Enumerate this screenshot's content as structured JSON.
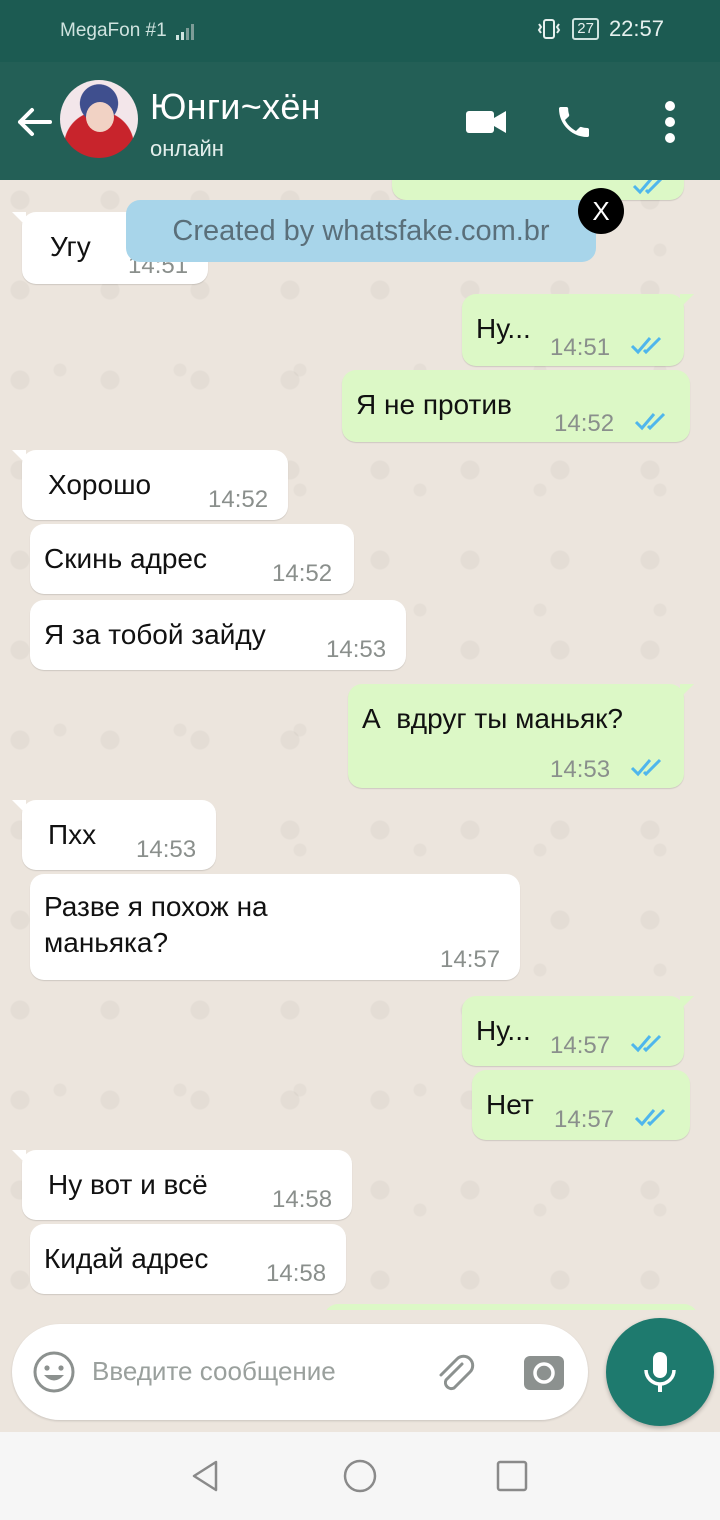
{
  "status_bar": {
    "carrier": "MegaFon #1",
    "battery": "27",
    "time": "22:57"
  },
  "header": {
    "contact_name": "Юнги~хён",
    "status": "онлайн"
  },
  "banner": {
    "text": "Created by whatsfake.com.br",
    "close_label": "X"
  },
  "messages": [
    {
      "dir": "in",
      "text": "Угу",
      "time": "14:51"
    },
    {
      "dir": "out",
      "text": "Ну...",
      "time": "14:51",
      "read": true
    },
    {
      "dir": "out",
      "text": "Я не против",
      "time": "14:52",
      "read": true
    },
    {
      "dir": "in",
      "text": "Хорошо",
      "time": "14:52"
    },
    {
      "dir": "in",
      "text": "Скинь адрес",
      "time": "14:52"
    },
    {
      "dir": "in",
      "text": "Я за тобой зайду",
      "time": "14:53"
    },
    {
      "dir": "out",
      "text": "А  вдруг ты маньяк?",
      "time": "14:53",
      "read": true
    },
    {
      "dir": "in",
      "text": "Пхх",
      "time": "14:53"
    },
    {
      "dir": "in",
      "text_line1": "Разве я похож на",
      "text_line2": "маньяка?",
      "time": "14:57"
    },
    {
      "dir": "out",
      "text": "Ну...",
      "time": "14:57",
      "read": true
    },
    {
      "dir": "out",
      "text": "Нет",
      "time": "14:57",
      "read": true
    },
    {
      "dir": "in",
      "text": "Ну вот и всё",
      "time": "14:58"
    },
    {
      "dir": "in",
      "text": "Кидай адрес",
      "time": "14:58"
    }
  ],
  "composer": {
    "placeholder": "Введите сообщение"
  },
  "colors": {
    "header": "#235f56",
    "status_bar": "#1c5b52",
    "outgoing_bubble": "#dcf8c6",
    "incoming_bubble": "#ffffff",
    "read_ticks": "#4fb6ec",
    "mic_button": "#1e7a6e"
  }
}
